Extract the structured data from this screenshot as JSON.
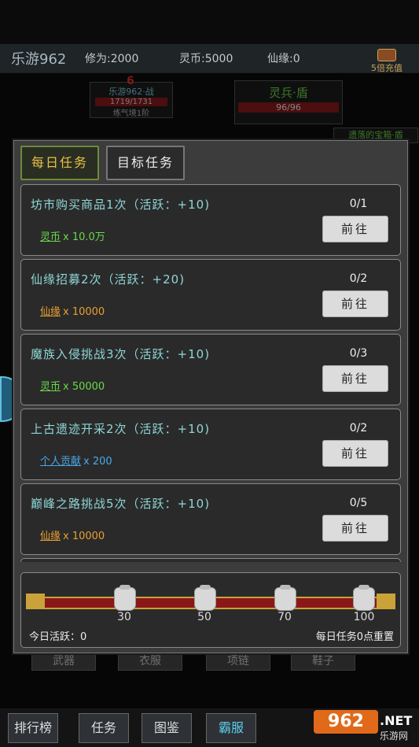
{
  "header": {
    "brand": "乐游962",
    "cultivation": "修为:2000",
    "spirit_coin": "灵币:5000",
    "xianyuan": "仙缘:0",
    "recharge": "5倍充值"
  },
  "hud_left": {
    "badge": "6",
    "name": "乐游962·战",
    "hp": "1719/1731",
    "realm": "练气境1阶"
  },
  "hud_right": {
    "name": "灵兵·盾",
    "hp": "96/96"
  },
  "hud_side": {
    "label": "遗落的宝箱·盾"
  },
  "background_tabs": [
    "武器",
    "衣服",
    "项链",
    "鞋子"
  ],
  "tabs": [
    {
      "label": "每日任务",
      "active": true
    },
    {
      "label": "目标任务",
      "active": false
    }
  ],
  "tasks": [
    {
      "title": "坊市购买商品1次（活跃：+10)",
      "reward_name": "灵币",
      "reward_amount": "x 10.0万",
      "reward_color": "#6ad84a",
      "progress": "0/1",
      "button": "前往"
    },
    {
      "title": "仙缘招募2次（活跃：+20)",
      "reward_name": "仙缘",
      "reward_amount": "x 10000",
      "reward_color": "#e8a030",
      "progress": "0/2",
      "button": "前往"
    },
    {
      "title": "魔族入侵挑战3次（活跃：+10)",
      "reward_name": "灵币",
      "reward_amount": "x 50000",
      "reward_color": "#6ad84a",
      "progress": "0/3",
      "button": "前往"
    },
    {
      "title": "上古遗迹开采2次（活跃：+10)",
      "reward_name": "个人贡献",
      "reward_amount": "x 200",
      "reward_color": "#4aa8e8",
      "progress": "0/2",
      "button": "前往"
    },
    {
      "title": "巅峰之路挑战5次（活跃：+10)",
      "reward_name": "仙缘",
      "reward_amount": "x 10000",
      "reward_color": "#e8a030",
      "progress": "0/5",
      "button": "前往"
    }
  ],
  "activity": {
    "milestones": [
      "30",
      "50",
      "70",
      "100"
    ],
    "today_label": "今日活跃：0",
    "reset_label": "每日任务0点重置"
  },
  "bottom_nav": [
    "排行榜",
    "任务",
    "图鉴",
    "霸服"
  ],
  "watermark": {
    "number": "962",
    "suffix": ".NET",
    "name": "乐游网"
  },
  "colors": {
    "tab_active_text": "#e7c04a",
    "task_title": "#8fd6d6",
    "track": "#8a1818"
  }
}
